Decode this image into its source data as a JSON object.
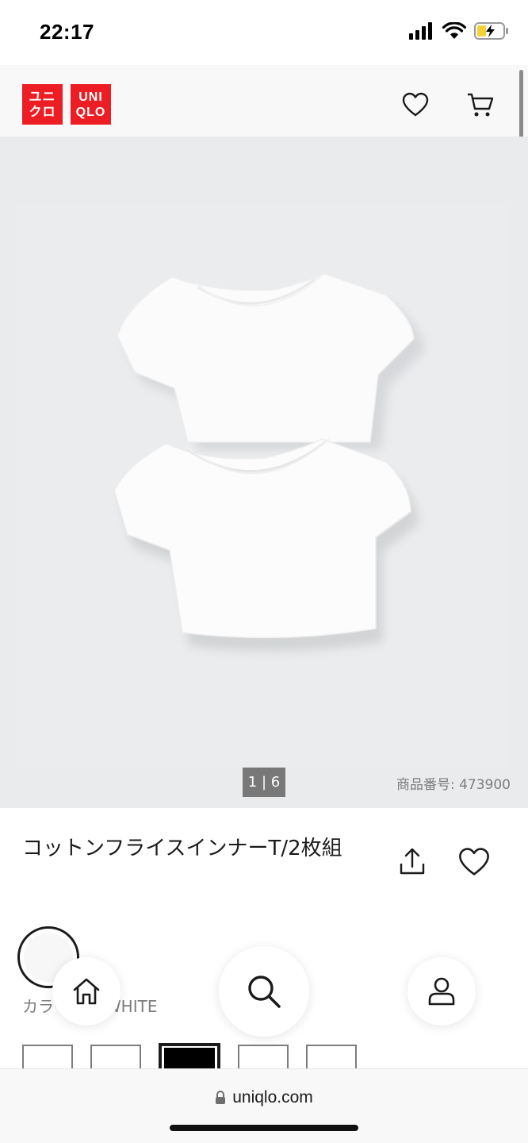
{
  "status_bar": {
    "time": "22:17"
  },
  "header": {
    "logo_katakana": [
      "ユニ",
      "クロ"
    ],
    "logo_latin": [
      "UNI",
      "QLO"
    ],
    "brand_color": "#ed1d24",
    "icons": [
      "heart-icon",
      "cart-icon"
    ]
  },
  "gallery": {
    "counter": "1 | 6",
    "product_number": "商品番号: 473900"
  },
  "product": {
    "title": "コットンフライスインナーT/2枚組",
    "color_label": "カラー: 00 WHITE"
  },
  "sizes": {
    "selected_index": 2,
    "count": 5
  },
  "bottom_nav": {
    "icons": [
      "home-icon",
      "search-icon",
      "user-icon"
    ]
  },
  "browser": {
    "url": "uniqlo.com"
  }
}
